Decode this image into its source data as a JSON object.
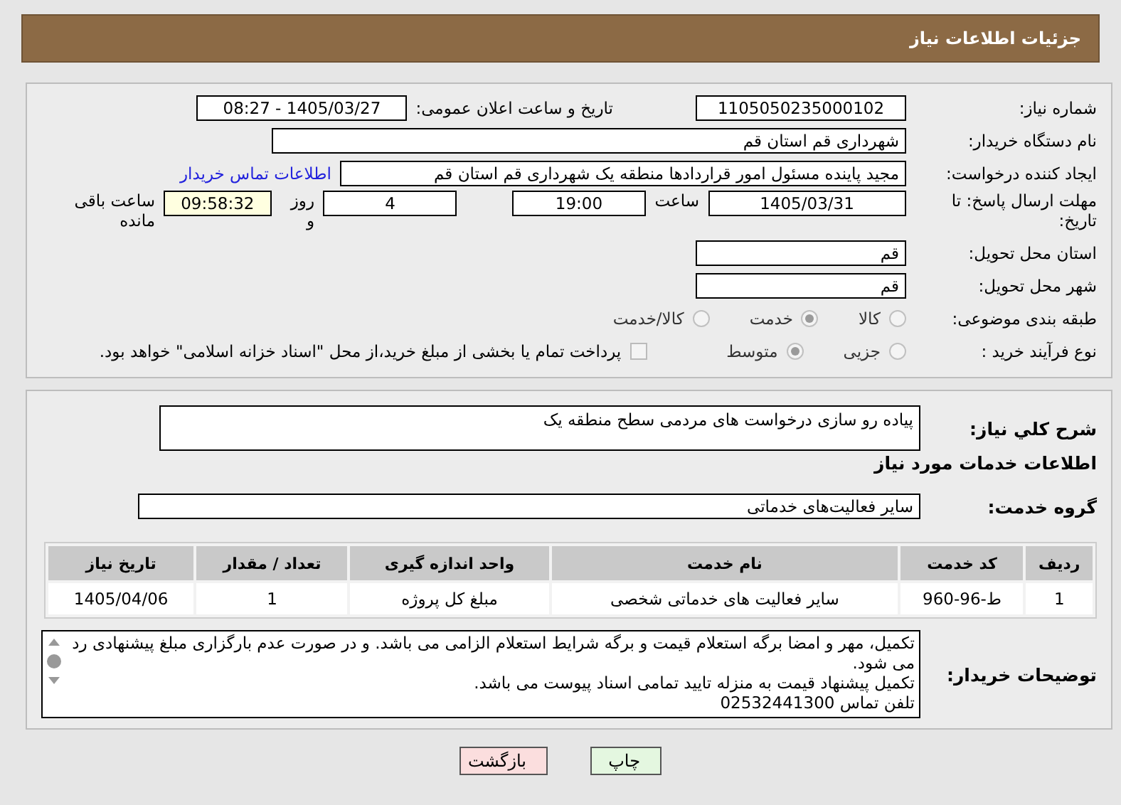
{
  "header": {
    "title": "جزئیات اطلاعات نیاز"
  },
  "details": {
    "need_number": {
      "label": "شماره نیاز:",
      "value": "1105050235000102"
    },
    "announce": {
      "label": "تاریخ و ساعت اعلان عمومی:",
      "value": "1405/03/27 - 08:27"
    },
    "buyer": {
      "label": "نام دستگاه خریدار:",
      "value": "شهرداری قم استان قم"
    },
    "creator": {
      "label": "ایجاد کننده درخواست:",
      "value": "مجید پاینده مسئول امور قراردادها منطقه یک شهرداری قم استان قم",
      "link": "اطلاعات تماس خریدار"
    },
    "deadline": {
      "label": "مهلت ارسال پاسخ: تا تاریخ:",
      "date": "1405/03/31",
      "time_label": "ساعت",
      "time": "19:00",
      "days": "4",
      "days_label": "روز و",
      "remaining": "09:58:32",
      "remaining_label": "ساعت باقی مانده"
    },
    "province": {
      "label": "استان محل تحویل:",
      "value": "قم"
    },
    "city": {
      "label": "شهر محل تحویل:",
      "value": "قم"
    },
    "category": {
      "label": "طبقه بندی موضوعی:",
      "options": [
        {
          "label": "کالا",
          "selected": false
        },
        {
          "label": "خدمت",
          "selected": true
        },
        {
          "label": "کالا/خدمت",
          "selected": false
        }
      ]
    },
    "process": {
      "label": "نوع فرآیند خرید :",
      "options": [
        {
          "label": "جزیی",
          "selected": false
        },
        {
          "label": "متوسط",
          "selected": true
        }
      ],
      "payment": {
        "label": "پرداخت تمام یا بخشی از مبلغ خرید،از محل \"اسناد خزانه اسلامی\" خواهد بود.",
        "checked": false
      }
    }
  },
  "summary": {
    "label": "شرح کلي نياز:",
    "value": "پیاده رو سازی درخواست های مردمی سطح منطقه یک"
  },
  "services_title": "اطلاعات خدمات مورد نیاز",
  "service_group": {
    "label": "گروه خدمت:",
    "value": "سایر فعالیت‌های خدماتی"
  },
  "table": {
    "columns": [
      "ردیف",
      "کد خدمت",
      "نام خدمت",
      "واحد اندازه گیری",
      "تعداد / مقدار",
      "تاریخ نیاز"
    ],
    "rows": [
      [
        "1",
        "ط-96-960",
        "سایر فعالیت های خدماتی شخصی",
        "مبلغ کل پروژه",
        "1",
        "1405/04/06"
      ]
    ]
  },
  "buyer_notes": {
    "label": "توضیحات خریدار:",
    "lines": [
      "تکمیل، مهر و امضا برگه استعلام قیمت و برگه شرایط استعلام الزامی می باشد. و در صورت عدم بارگزاری مبلغ پیشنهادی رد می شود.",
      "تکمیل پیشنهاد قیمت به منزله تایید تمامی اسناد پیوست می باشد.",
      "تلفن تماس  02532441300"
    ]
  },
  "buttons": [
    {
      "label": "چاپ",
      "kind": "print"
    },
    {
      "label": "بازگشت",
      "kind": "back"
    }
  ]
}
